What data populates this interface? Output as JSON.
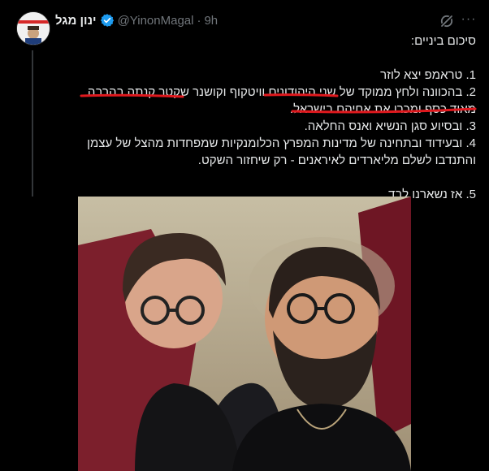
{
  "post": {
    "author_name": "ינון מגל",
    "handle": "@YinonMagal",
    "separator": "·",
    "time": "9h",
    "more_label": "···",
    "lines": [
      "סיכום ביניים:",
      "",
      "1. טראמפ יצא לוזר",
      "2. בהכוונה ולחץ ממוקד של שני היהודונים וויטקוף וקושנר שקטר קנתה בהרבה",
      "מאוד כסף ומכרו את אחיהם בישראל.",
      "3. ובסיוע סגן הנשיא ואנס החלאה.",
      "4. ובעידוד ובתחינה של מדינות המפרץ הכלומנקיות שמפחדות מהצל של עצמן",
      "והתנדבו לשלם מליארדים לאיראנים - רק שיחזור השקט.",
      "",
      "5. אז נשארנו לבד."
    ]
  },
  "colors": {
    "background": "#000000",
    "text": "#e7e9ea",
    "muted": "#71767b",
    "verified": "#1d9bf0",
    "annotation": "#e0191e"
  },
  "icons": {
    "verified": "verified-badge-icon",
    "grok": "grok-icon",
    "more": "more-icon"
  }
}
